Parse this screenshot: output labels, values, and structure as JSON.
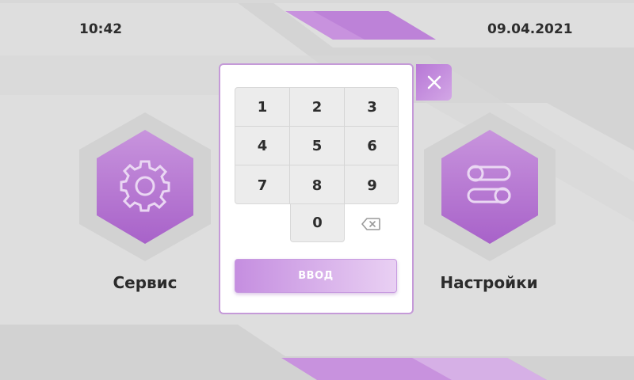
{
  "status": {
    "time": "10:42",
    "date": "09.04.2021"
  },
  "tiles": [
    {
      "label": "Сервис",
      "icon": "gear-icon"
    },
    {
      "label": "Настройки",
      "icon": "toggles-icon"
    }
  ],
  "keypad": {
    "keys": [
      "1",
      "2",
      "3",
      "4",
      "5",
      "6",
      "7",
      "8",
      "9"
    ],
    "zero": "0",
    "backspace_icon": "backspace-icon",
    "enter_label": "ВВОД",
    "close_icon": "close-icon"
  },
  "colors": {
    "accent": "#b777d6",
    "background": "#dedede"
  }
}
